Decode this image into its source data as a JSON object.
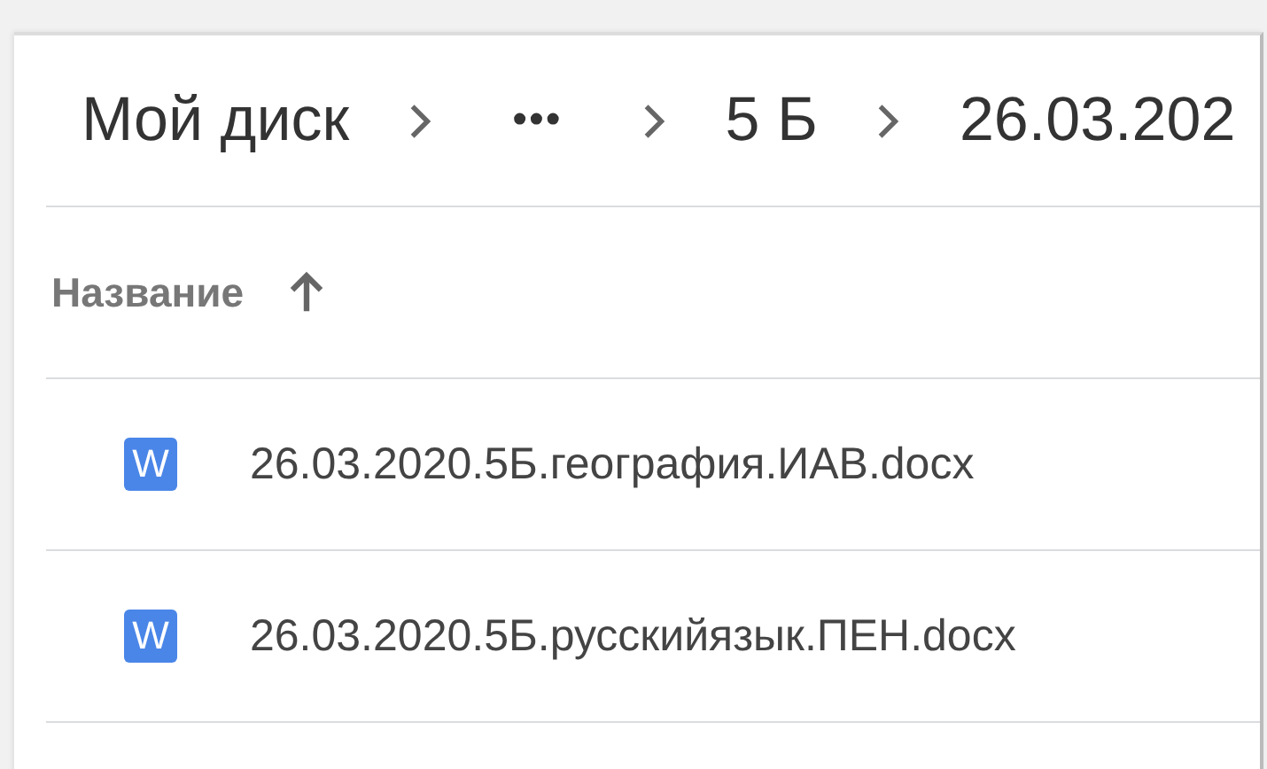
{
  "breadcrumb": [
    {
      "kind": "folder",
      "label": "Мой диск"
    },
    {
      "kind": "more",
      "label": "•••"
    },
    {
      "kind": "folder",
      "label": "5 Б"
    },
    {
      "kind": "folder",
      "label": "26.03.202"
    }
  ],
  "columns": [
    {
      "label": "Название",
      "sort_ascending": true
    }
  ],
  "files": [
    {
      "kind": "word",
      "icon_text": "W",
      "name": "26.03.2020.5Б.география.ИАВ.docx"
    },
    {
      "kind": "word",
      "icon_text": "W",
      "name": "26.03.2020.5Б.русскийязык.ПЕН.docx"
    }
  ]
}
